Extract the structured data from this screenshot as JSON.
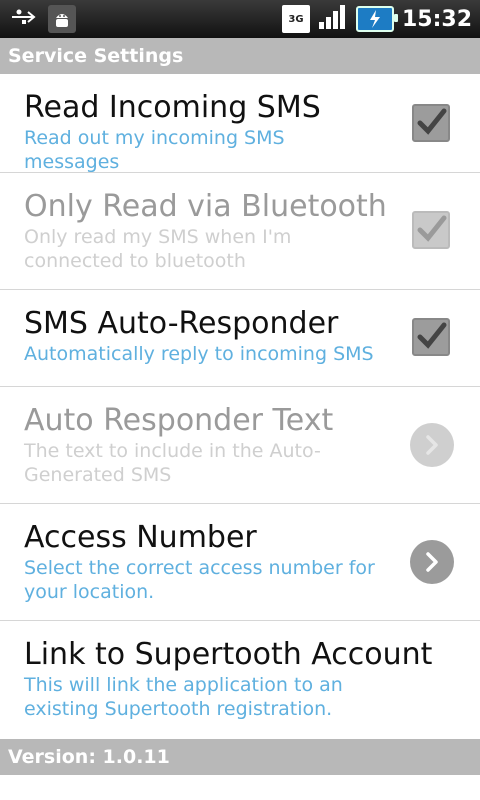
{
  "statusbar": {
    "usb_icon": "usb-icon",
    "android_icon": "android-debug-icon",
    "network_label": "3G",
    "signal_icon": "signal-bars-icon",
    "battery_icon": "battery-charging-icon",
    "time": "15:32"
  },
  "header": {
    "title": "Service Settings"
  },
  "items": [
    {
      "title": "Read Incoming SMS",
      "summary": "Read out my incoming SMS messages",
      "control": "checkbox",
      "checked": true,
      "enabled": true
    },
    {
      "title": "Only Read via Bluetooth",
      "summary": "Only read my SMS when I'm connected to bluetooth",
      "control": "checkbox",
      "checked": true,
      "enabled": false
    },
    {
      "title": "SMS Auto-Responder",
      "summary": "Automatically reply to incoming SMS",
      "control": "checkbox",
      "checked": true,
      "enabled": true
    },
    {
      "title": "Auto Responder Text",
      "summary": "The text to include in the Auto-Generated SMS",
      "control": "chevron",
      "enabled": false
    },
    {
      "title": "Access Number",
      "summary": "Select the correct access number for your location.",
      "control": "chevron",
      "enabled": true
    },
    {
      "title": "Link to Supertooth Account",
      "summary": "This will link the application to an existing Supertooth registration.",
      "control": "none",
      "enabled": true
    }
  ],
  "footer": {
    "version": "Version: 1.0.11"
  },
  "colors": {
    "accent": "#5fb0df",
    "header_bg": "#b8b8b8"
  }
}
